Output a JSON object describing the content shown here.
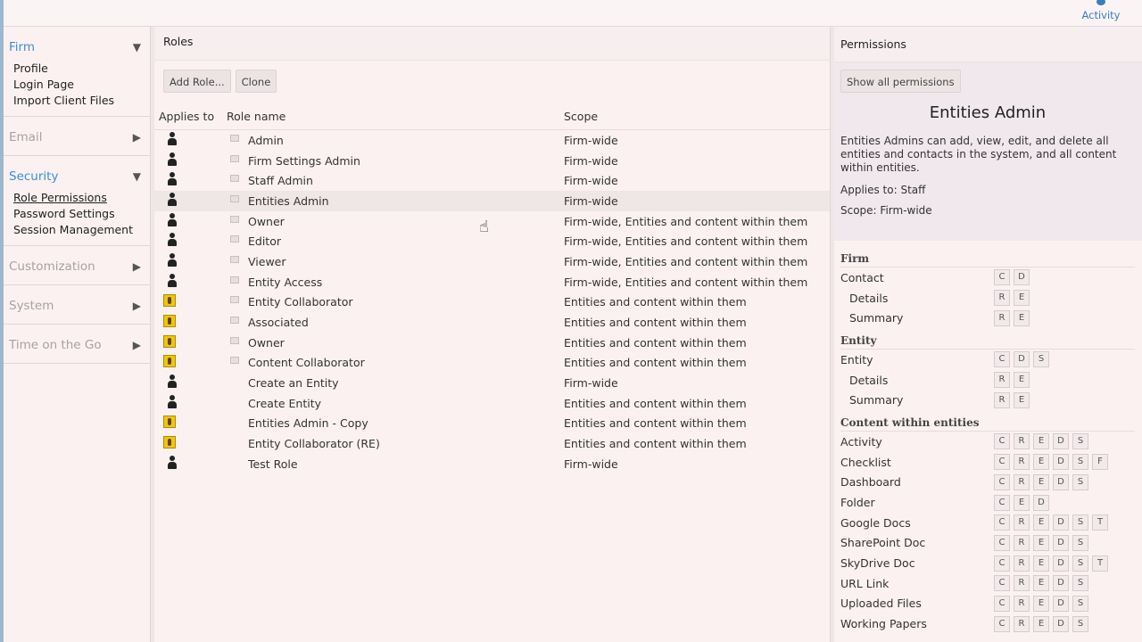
{
  "topbar": {
    "activity_label": "Activity"
  },
  "sidebar": {
    "sections": [
      {
        "label": "Firm",
        "open": true,
        "items": [
          "Profile",
          "Login Page",
          "Import Client Files"
        ]
      },
      {
        "label": "Email",
        "open": false,
        "items": []
      },
      {
        "label": "Security",
        "open": true,
        "items": [
          "Role Permissions",
          "Password Settings",
          "Session Management"
        ]
      },
      {
        "label": "Customization",
        "open": false,
        "items": []
      },
      {
        "label": "System",
        "open": false,
        "items": []
      },
      {
        "label": "Time on the Go",
        "open": false,
        "items": []
      }
    ]
  },
  "roles": {
    "title": "Roles",
    "add_label": "Add Role...",
    "clone_label": "Clone",
    "col_applies": "Applies to",
    "col_name": "Role name",
    "col_scope": "Scope",
    "rows": [
      {
        "applies": "staff",
        "locked": true,
        "name": "Admin",
        "scope": "Firm-wide"
      },
      {
        "applies": "staff",
        "locked": true,
        "name": "Firm Settings Admin",
        "scope": "Firm-wide"
      },
      {
        "applies": "staff",
        "locked": true,
        "name": "Staff Admin",
        "scope": "Firm-wide"
      },
      {
        "applies": "staff",
        "locked": true,
        "name": "Entities Admin",
        "scope": "Firm-wide",
        "selected": true
      },
      {
        "applies": "staff",
        "locked": true,
        "name": "Owner",
        "scope": "Firm-wide, Entities and content within them"
      },
      {
        "applies": "staff",
        "locked": true,
        "name": "Editor",
        "scope": "Firm-wide, Entities and content within them"
      },
      {
        "applies": "staff",
        "locked": true,
        "name": "Viewer",
        "scope": "Firm-wide, Entities and content within them"
      },
      {
        "applies": "staff",
        "locked": true,
        "name": "Entity Access",
        "scope": "Firm-wide, Entities and content within them"
      },
      {
        "applies": "entity",
        "locked": true,
        "name": "Entity Collaborator",
        "scope": "Entities and content within them"
      },
      {
        "applies": "entity",
        "locked": true,
        "name": "Associated",
        "scope": "Entities and content within them"
      },
      {
        "applies": "entity",
        "locked": true,
        "name": "Owner",
        "scope": "Entities and content within them"
      },
      {
        "applies": "entity",
        "locked": true,
        "name": "Content Collaborator",
        "scope": "Entities and content within them"
      },
      {
        "applies": "staff",
        "locked": false,
        "name": "Create an Entity",
        "scope": "Firm-wide"
      },
      {
        "applies": "staff",
        "locked": false,
        "name": "Create Entity",
        "scope": "Entities and content within them"
      },
      {
        "applies": "entity",
        "locked": false,
        "name": "Entities Admin - Copy",
        "scope": "Entities and content within them"
      },
      {
        "applies": "entity",
        "locked": false,
        "name": "Entity Collaborator (RE)",
        "scope": "Entities and content within them"
      },
      {
        "applies": "staff",
        "locked": false,
        "name": "Test Role",
        "scope": "Firm-wide"
      }
    ]
  },
  "permissions": {
    "title": "Permissions",
    "show_all_label": "Show all permissions",
    "role_name": "Entities Admin",
    "description": "Entities Admins can add, view, edit, and delete all entities and contacts in the system, and all content within entities.",
    "applies_to": "Applies to: Staff",
    "scope": "Scope: Firm-wide",
    "groups": [
      {
        "name": "Firm",
        "items": [
          {
            "name": "Contact",
            "indent": false,
            "flags": [
              "C",
              "D"
            ]
          },
          {
            "name": "Details",
            "indent": true,
            "flags": [
              "R",
              "E"
            ]
          },
          {
            "name": "Summary",
            "indent": true,
            "flags": [
              "R",
              "E"
            ]
          }
        ]
      },
      {
        "name": "Entity",
        "items": [
          {
            "name": "Entity",
            "indent": false,
            "flags": [
              "C",
              "D",
              "S"
            ]
          },
          {
            "name": "Details",
            "indent": true,
            "flags": [
              "R",
              "E"
            ]
          },
          {
            "name": "Summary",
            "indent": true,
            "flags": [
              "R",
              "E"
            ]
          }
        ]
      },
      {
        "name": "Content within entities",
        "items": [
          {
            "name": "Activity",
            "indent": false,
            "flags": [
              "C",
              "R",
              "E",
              "D",
              "S"
            ]
          },
          {
            "name": "Checklist",
            "indent": false,
            "flags": [
              "C",
              "R",
              "E",
              "D",
              "S",
              "F"
            ]
          },
          {
            "name": "Dashboard",
            "indent": false,
            "flags": [
              "C",
              "R",
              "E",
              "D",
              "S"
            ]
          },
          {
            "name": "Folder",
            "indent": false,
            "flags": [
              "C",
              "E",
              "D"
            ]
          },
          {
            "name": "Google Docs",
            "indent": false,
            "flags": [
              "C",
              "R",
              "E",
              "D",
              "S",
              "T"
            ]
          },
          {
            "name": "SharePoint Doc",
            "indent": false,
            "flags": [
              "C",
              "R",
              "E",
              "D",
              "S"
            ]
          },
          {
            "name": "SkyDrive Doc",
            "indent": false,
            "flags": [
              "C",
              "R",
              "E",
              "D",
              "S",
              "T"
            ]
          },
          {
            "name": "URL Link",
            "indent": false,
            "flags": [
              "C",
              "R",
              "E",
              "D",
              "S"
            ]
          },
          {
            "name": "Uploaded Files",
            "indent": false,
            "flags": [
              "C",
              "R",
              "E",
              "D",
              "S"
            ]
          },
          {
            "name": "Working Papers",
            "indent": false,
            "flags": [
              "C",
              "R",
              "E",
              "D",
              "S"
            ]
          }
        ]
      }
    ]
  }
}
